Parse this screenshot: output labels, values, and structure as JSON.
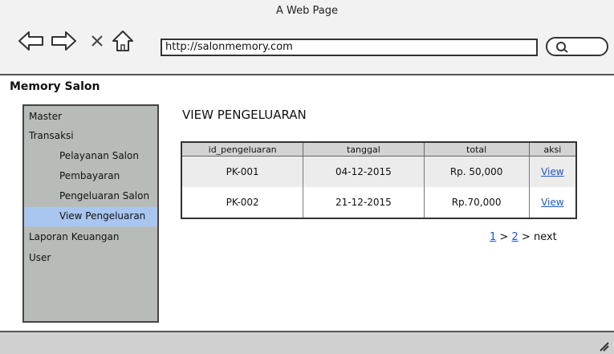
{
  "browser": {
    "title": "A Web Page",
    "url": "http://salonmemory.com"
  },
  "app": {
    "title": "Memory Salon"
  },
  "sidebar": {
    "items": [
      {
        "label": "Master",
        "level": "top"
      },
      {
        "label": "Transaksi",
        "level": "top"
      },
      {
        "label": "Pelayanan Salon",
        "level": "sub"
      },
      {
        "label": "Pembayaran",
        "level": "sub"
      },
      {
        "label": "Pengeluaran Salon",
        "level": "sub"
      },
      {
        "label": "View Pengeluaran",
        "level": "sub",
        "active": true
      },
      {
        "label": "Laporan Keuangan",
        "level": "top"
      },
      {
        "label": "User",
        "level": "top"
      }
    ]
  },
  "main": {
    "heading": "VIEW PENGELUARAN",
    "table": {
      "headers": [
        "id_pengeluaran",
        "tanggal",
        "total",
        "aksi"
      ],
      "rows": [
        [
          "PK-001",
          "04-12-2015",
          "Rp. 50,000",
          "View"
        ],
        [
          "PK-002",
          "21-12-2015",
          "Rp.70,000",
          "View"
        ]
      ]
    },
    "pagination": {
      "page1": "1",
      "sep1": ">",
      "page2": "2",
      "sep2": ">",
      "next": "next"
    }
  },
  "colors": {
    "sidebar_bg": "#b8bcb8",
    "active_item": "#a9c6f0",
    "link": "#2255cc"
  },
  "icons": [
    "back-arrow-icon",
    "forward-arrow-icon",
    "close-icon",
    "home-icon",
    "search-icon",
    "resize-grip-icon"
  ]
}
